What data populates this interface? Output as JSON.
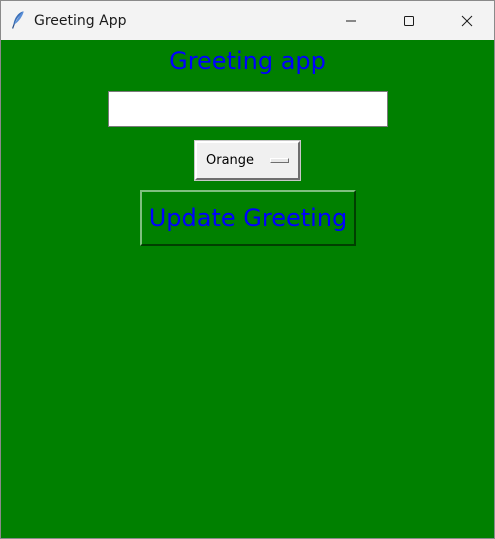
{
  "window": {
    "title": "Greeting App",
    "app_icon": "feather-icon",
    "controls": {
      "minimize_icon": "minimize-icon",
      "maximize_icon": "maximize-icon",
      "close_icon": "close-icon"
    }
  },
  "main": {
    "heading": "Greeting app",
    "name_input": {
      "value": "",
      "placeholder": ""
    },
    "color_select": {
      "selected": "Orange"
    },
    "update_button_label": "Update Greeting"
  },
  "colors": {
    "background": "#008000",
    "text_accent": "#0000ff",
    "titlebar": "#f3f3f3"
  }
}
